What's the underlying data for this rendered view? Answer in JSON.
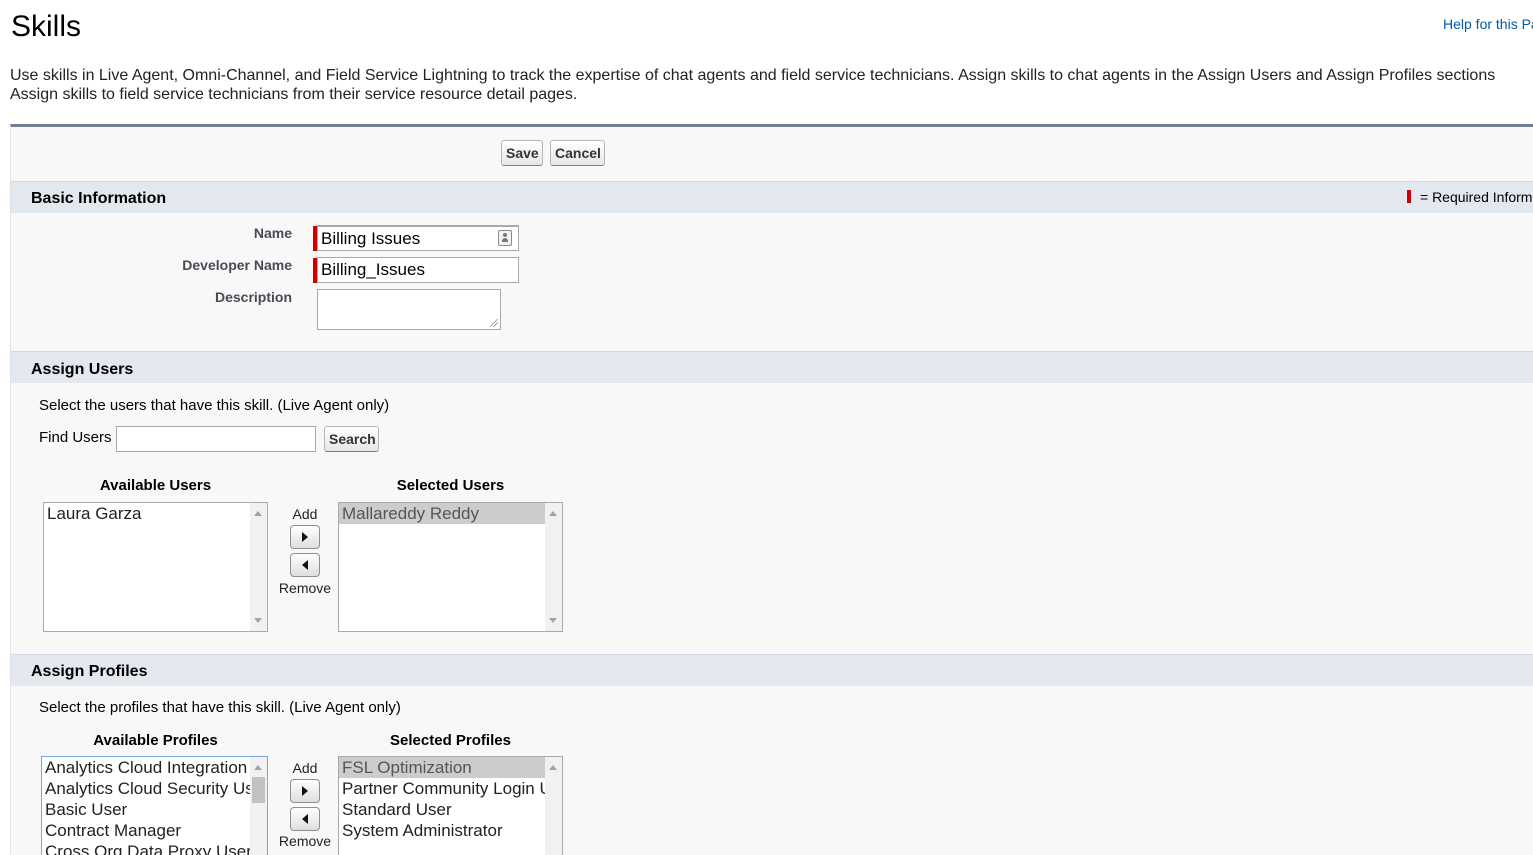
{
  "page": {
    "title": "Skills",
    "help_link": "Help for this Pa",
    "intro_line1": "Use skills in Live Agent, Omni-Channel, and Field Service Lightning to track the expertise of chat agents and field service technicians. Assign skills to chat agents in the Assign Users and Assign Profiles sections",
    "intro_line2": "Assign skills to field service technicians from their service resource detail pages."
  },
  "toolbar": {
    "save_label": "Save",
    "cancel_label": "Cancel"
  },
  "basic_info": {
    "title": "Basic Information",
    "required_legend": "= Required Informa",
    "name_label": "Name",
    "name_value": "Billing Issues",
    "developer_name_label": "Developer Name",
    "developer_name_value": "Billing_Issues",
    "description_label": "Description"
  },
  "assign_users": {
    "title": "Assign Users",
    "instructions": "Select the users that have this skill. (Live Agent only)",
    "find_label": "Find Users",
    "search_button": "Search",
    "available_label": "Available Users",
    "selected_label": "Selected Users",
    "available": [
      "Laura Garza"
    ],
    "selected": [
      "Mallareddy Reddy"
    ],
    "add_label": "Add",
    "remove_label": "Remove"
  },
  "assign_profiles": {
    "title": "Assign Profiles",
    "instructions": "Select the profiles that have this skill. (Live Agent only)",
    "available_label": "Available Profiles",
    "selected_label": "Selected Profiles",
    "available": [
      "Analytics Cloud Integration",
      "Analytics Cloud Security Us",
      "Basic User",
      "Contract Manager",
      "Cross Org Data Proxy User"
    ],
    "selected": [
      "FSL Optimization",
      "Partner Community Login U",
      "Standard User",
      "System Administrator"
    ],
    "add_label": "Add",
    "remove_label": "Remove"
  },
  "colors": {
    "required": "#cc0000",
    "section_header": "#e3e7ee",
    "panel_border": "#6f7e91",
    "link": "#015ba7"
  }
}
